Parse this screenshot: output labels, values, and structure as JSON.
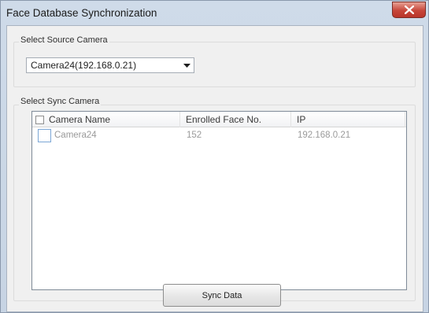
{
  "window": {
    "title": "Face Database Synchronization"
  },
  "source": {
    "group_label": "Select Source Camera",
    "selected_camera": "Camera24(192.168.0.21)"
  },
  "sync": {
    "group_label": "Select Sync Camera",
    "columns": [
      "Camera Name",
      "Enrolled Face No.",
      "IP"
    ],
    "rows": [
      {
        "checked": false,
        "name": "Camera24",
        "faces": "152",
        "ip": "192.168.0.21"
      }
    ]
  },
  "actions": {
    "sync_label": "Sync Data"
  },
  "colors": {
    "title_bar": "#cfdbe9",
    "close_button": "#c7463a",
    "dialog_bg": "#f0f0f0",
    "row_text": "#9a9a9a"
  },
  "icons": {
    "close": "close-icon",
    "dropdown": "chevron-down-icon"
  }
}
